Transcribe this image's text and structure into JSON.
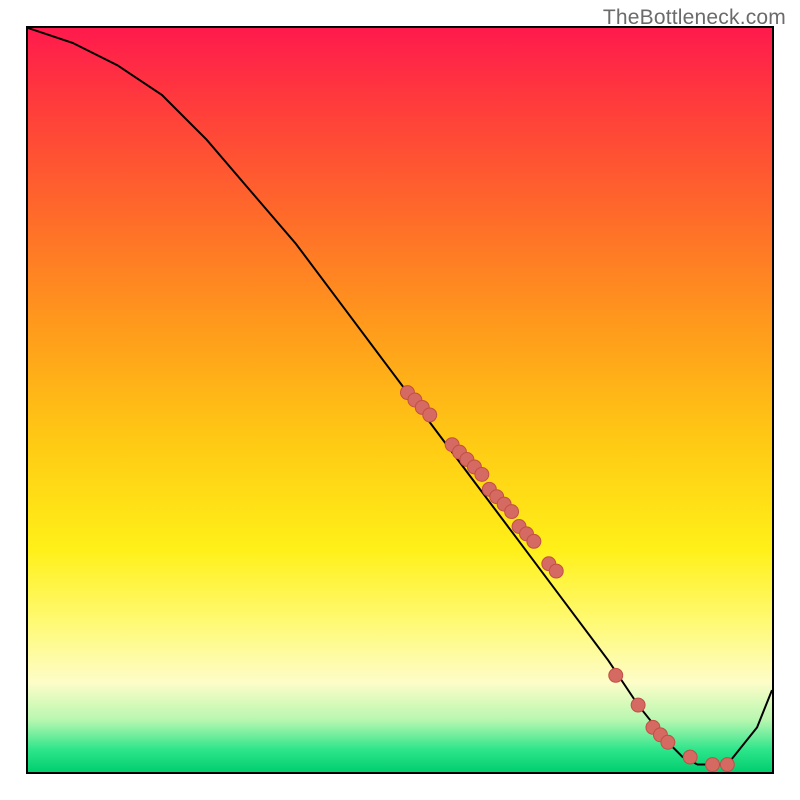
{
  "watermark": "TheBottleneck.com",
  "chart_data": {
    "type": "line",
    "title": "",
    "xlabel": "",
    "ylabel": "",
    "xlim": [
      0,
      100
    ],
    "ylim": [
      0,
      100
    ],
    "grid": false,
    "legend": false,
    "series": [
      {
        "name": "bottleneck-curve",
        "x": [
          0,
          6,
          12,
          18,
          24,
          30,
          36,
          42,
          48,
          54,
          60,
          66,
          72,
          78,
          82,
          86,
          88,
          90,
          94,
          98,
          100
        ],
        "values": [
          100,
          98,
          95,
          91,
          85,
          78,
          71,
          63,
          55,
          47,
          39,
          31,
          23,
          15,
          9,
          4,
          2,
          1,
          1,
          6,
          11
        ]
      }
    ],
    "scatter_points": {
      "name": "sample-points",
      "x": [
        51,
        52,
        53,
        54,
        57,
        58,
        59,
        60,
        61,
        62,
        63,
        64,
        65,
        66,
        67,
        68,
        70,
        71,
        79,
        82,
        84,
        85,
        86,
        89,
        92,
        94
      ],
      "values": [
        51,
        50,
        49,
        48,
        44,
        43,
        42,
        41,
        40,
        38,
        37,
        36,
        35,
        33,
        32,
        31,
        28,
        27,
        13,
        9,
        6,
        5,
        4,
        2,
        1,
        1
      ]
    },
    "background_gradient": {
      "type": "vertical",
      "stops": [
        {
          "pos": 0.0,
          "color": "#ff1a4d"
        },
        {
          "pos": 0.25,
          "color": "#ff6a2a"
        },
        {
          "pos": 0.55,
          "color": "#ffc814"
        },
        {
          "pos": 0.8,
          "color": "#fffa75"
        },
        {
          "pos": 0.93,
          "color": "#b8f7b0"
        },
        {
          "pos": 1.0,
          "color": "#00cf6f"
        }
      ]
    }
  }
}
